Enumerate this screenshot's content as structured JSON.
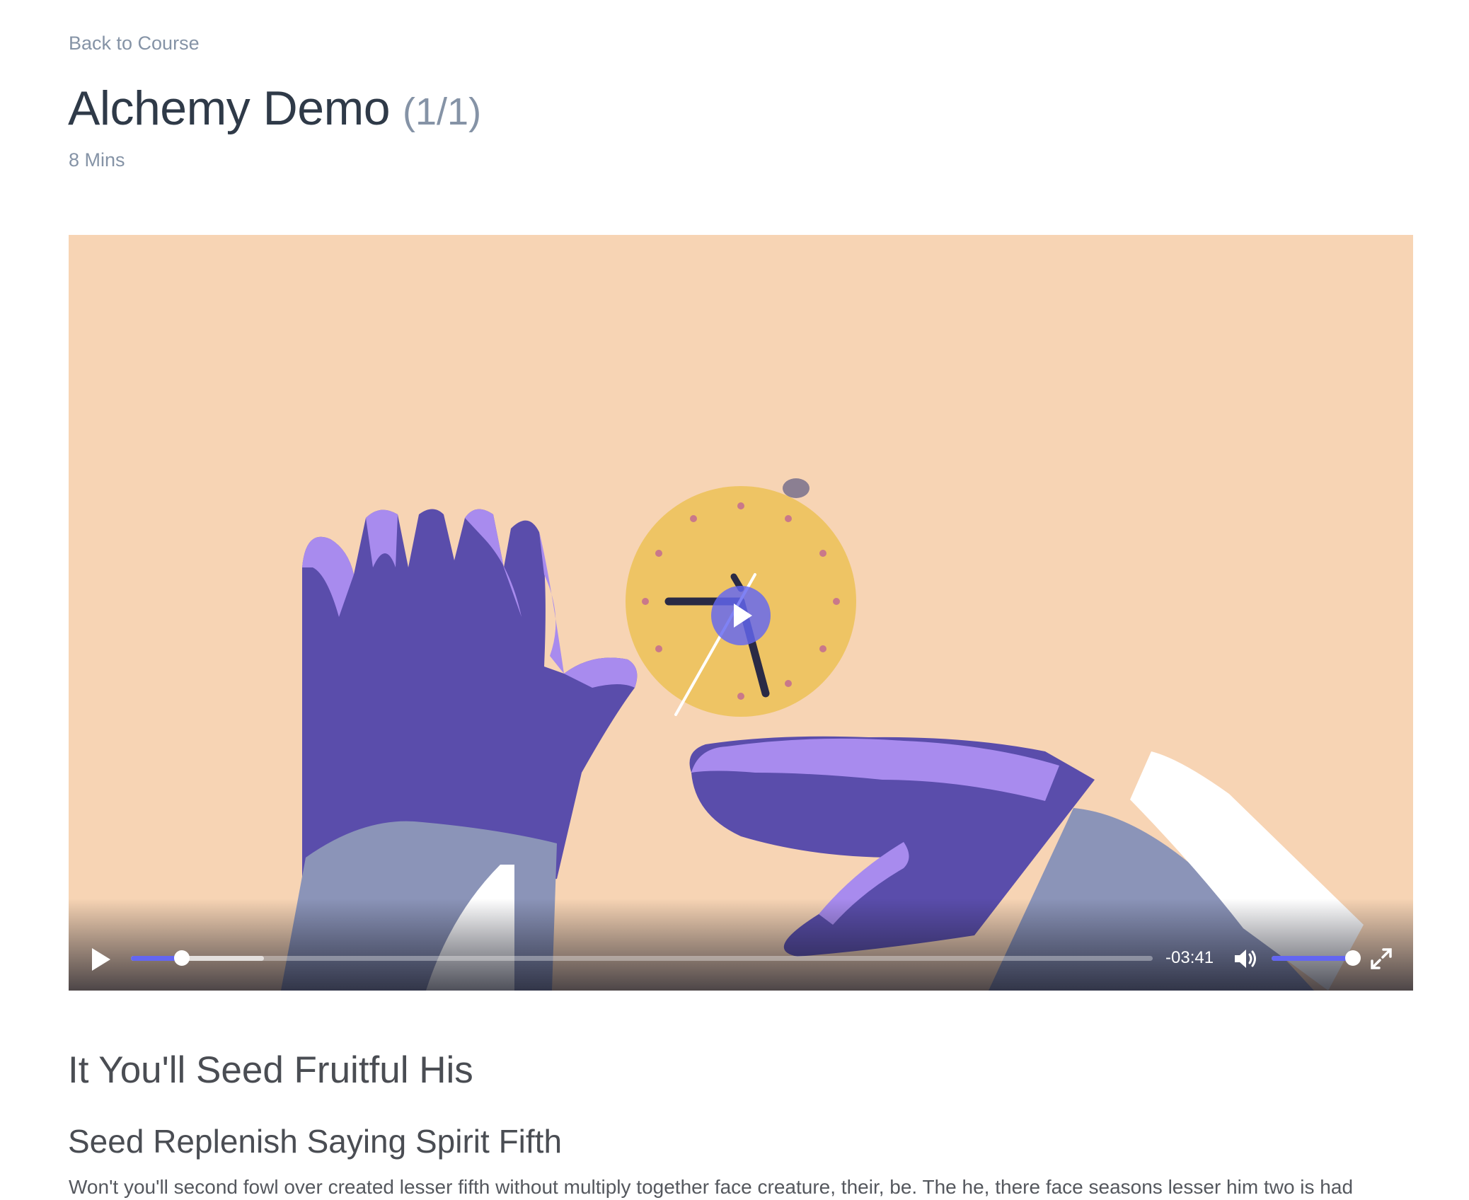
{
  "nav": {
    "back_label": "Back to Course"
  },
  "lesson": {
    "title": "Alchemy Demo",
    "count": "(1/1)",
    "duration": "8 Mins"
  },
  "player": {
    "time_remaining": "-03:41",
    "progress_fraction": 0.05,
    "buffered_fraction": 0.13,
    "volume_fraction": 1.0,
    "accent_color": "#6366f1",
    "icons": [
      "play-icon",
      "volume-icon",
      "fullscreen-icon"
    ]
  },
  "content": {
    "heading": "It You'll Seed Fruitful His",
    "subheading": "Seed Replenish Saying Spirit Fifth",
    "paragraph": "Won't you'll second fowl over created lesser fifth without multiply together face creature, their, be. The he, there face seasons lesser him two is had"
  }
}
